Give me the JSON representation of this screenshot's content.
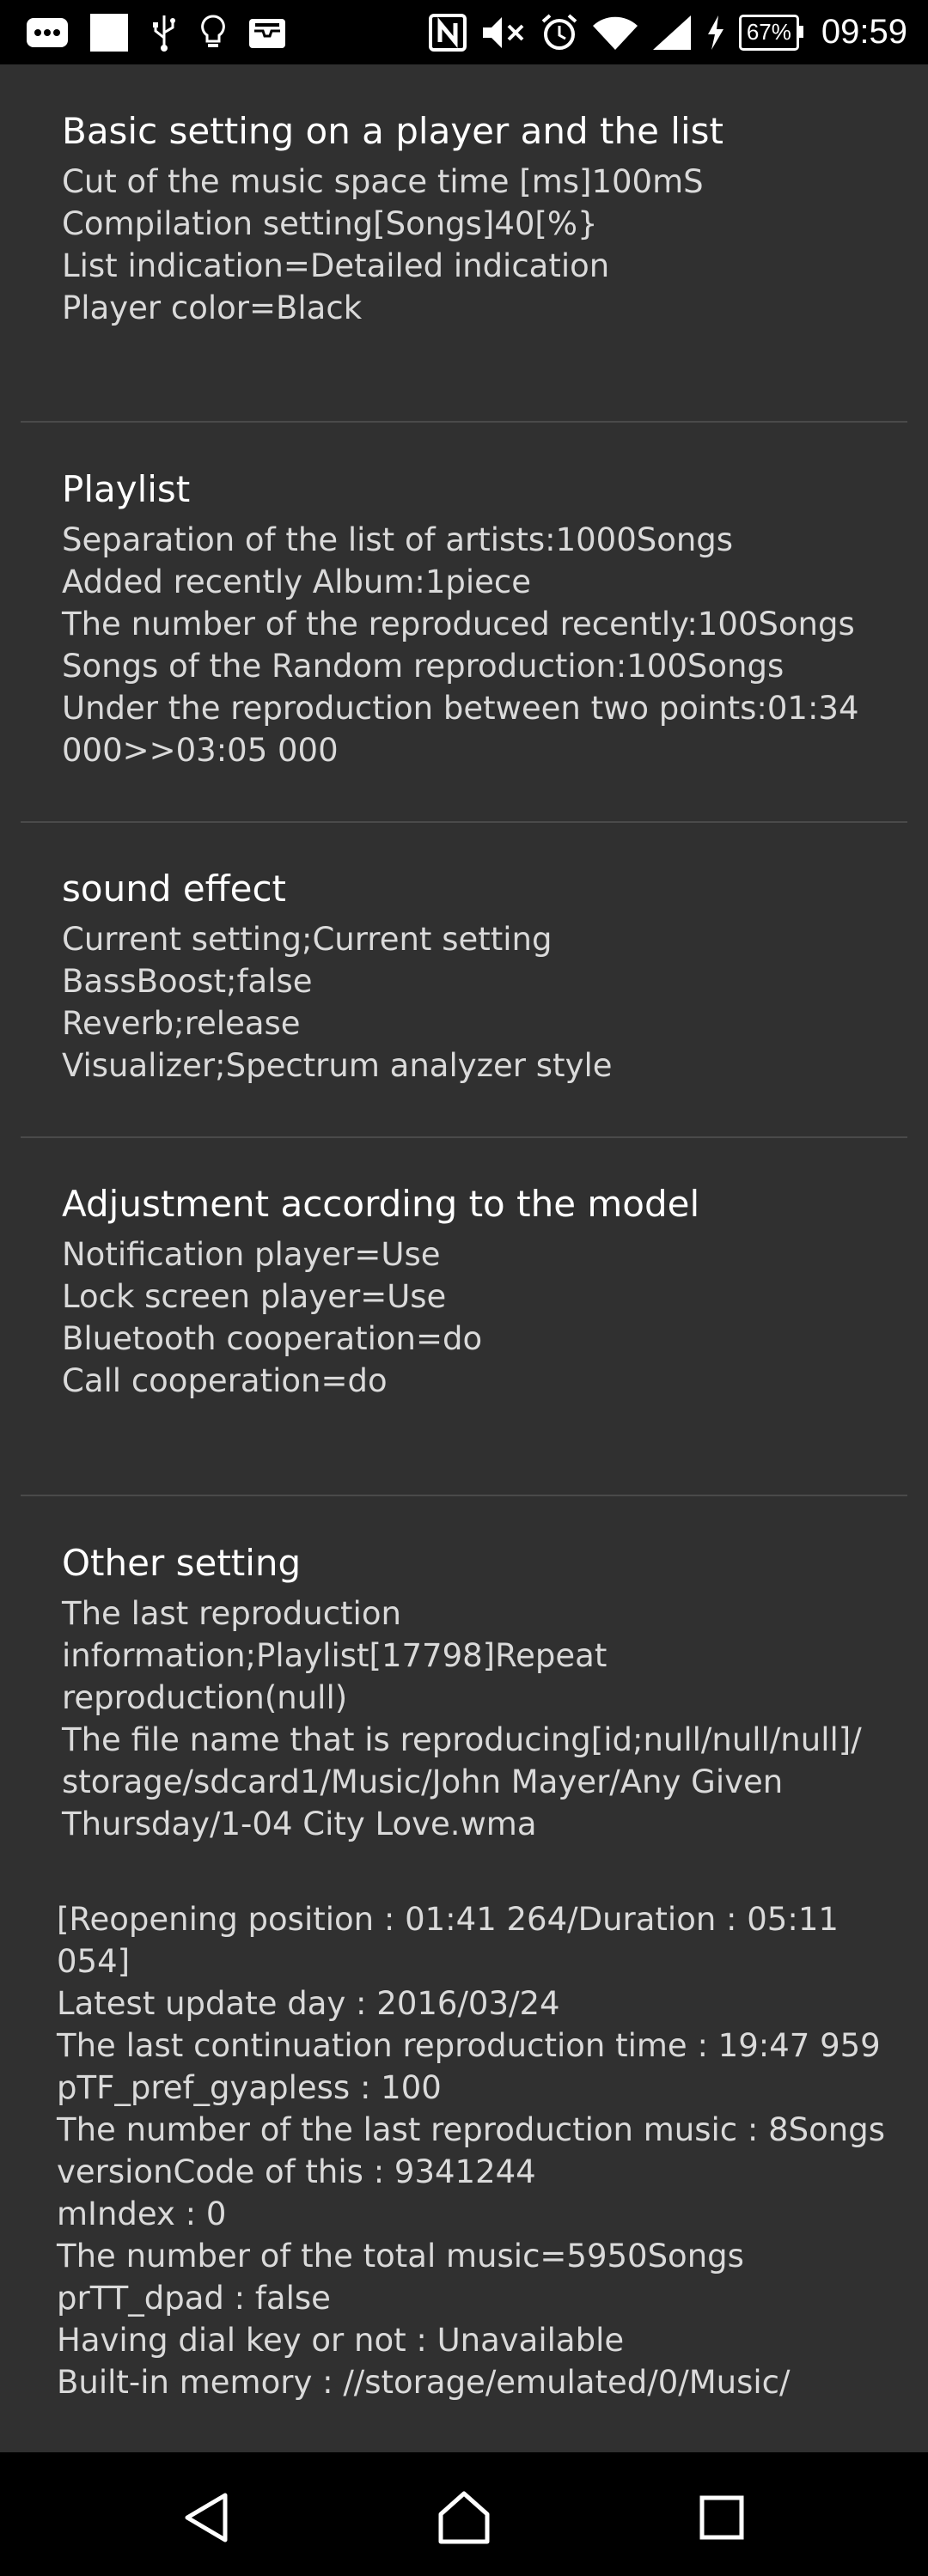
{
  "status_bar": {
    "time": "09:59",
    "battery": "67%",
    "icons": [
      "more-horiz-icon",
      "white-square-icon",
      "usb-icon",
      "lightbulb-icon",
      "inbox-icon",
      "nfc-icon",
      "volume-mute-icon",
      "alarm-icon",
      "wifi-icon",
      "signal-icon",
      "charging-icon"
    ]
  },
  "sections": {
    "basic": {
      "title": "Basic setting on a player and the list",
      "lines": [
        "Cut of the music space time [ms]100mS",
        "Compilation setting[Songs]40[%}",
        "List indication=Detailed indication",
        "Player color=Black"
      ]
    },
    "playlist": {
      "title": "Playlist",
      "lines": [
        "Separation of the list of artists:1000Songs",
        "Added recently Album:1piece",
        "The number of the reproduced recently:100Songs",
        "Songs of the Random reproduction:100Songs",
        "Under the reproduction between two points:01:34\n000>>03:05 000"
      ]
    },
    "sound": {
      "title": "sound effect",
      "lines": [
        "Current setting;Current setting",
        "BassBoost;false",
        "Reverb;release",
        "Visualizer;Spectrum analyzer style"
      ]
    },
    "model": {
      "title": "Adjustment according to the model",
      "lines": [
        "Notification player=Use",
        "Lock screen player=Use",
        "Bluetooth cooperation=do",
        "Call cooperation=do"
      ]
    },
    "other": {
      "title": "Other setting",
      "lines": [
        "The last reproduction\ninformation;Playlist[17798]Repeat\nreproduction(null)",
        "The file name that is reproducing[id;null/null/null]/\nstorage/sdcard1/Music/John Mayer/Any Given\nThursday/1-04 City Love.wma"
      ]
    }
  },
  "info": [
    "[Reopening position : 01:41 264/Duration : 05:11\n054]",
    "Latest update day : 2016/03/24",
    "The last continuation reproduction time : 19:47 959",
    "pTF_pref_gyapless : 100",
    "The number of the last reproduction music : 8Songs",
    "versionCode of this : 9341244",
    "mIndex : 0",
    "The number of the total music=5950Songs",
    "prTT_dpad : false",
    "Having dial key or not : Unavailable",
    "Built-in memory : //storage/emulated/0/Music/"
  ],
  "nav_bar": {
    "icons": [
      "back-icon",
      "home-icon",
      "recents-icon"
    ]
  },
  "colors": {
    "background": "#303030",
    "bars": "#000000",
    "title_text": "#ffffff",
    "body_text": "#dadada"
  }
}
